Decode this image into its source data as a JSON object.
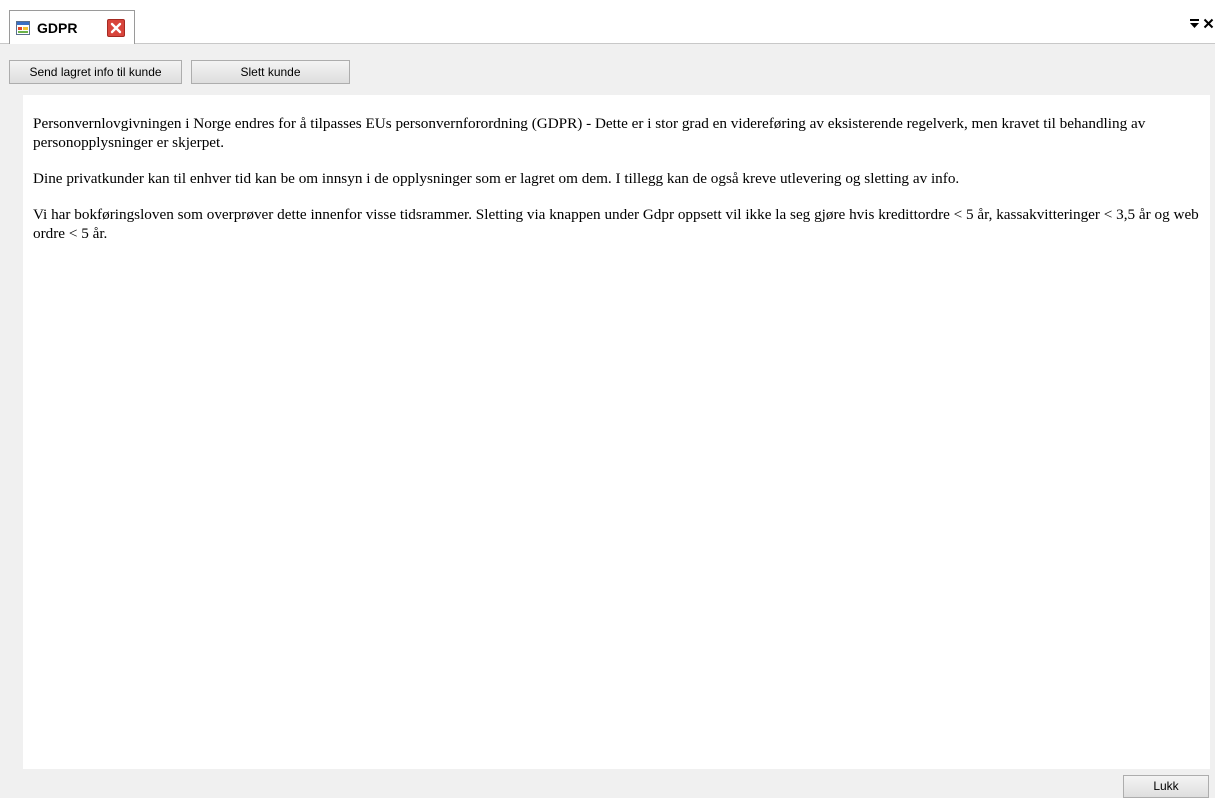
{
  "tab": {
    "title": "GDPR",
    "icon": "form-window-icon",
    "close_icon": "close-tab-icon"
  },
  "strip_controls": {
    "dropdown_icon": "tab-list-dropdown-icon",
    "close_icon": "close-icon"
  },
  "toolbar": {
    "send_label": "Send lagret info til kunde",
    "delete_label": "Slett kunde"
  },
  "content": {
    "paragraphs": [
      "Personvernlovgivningen i Norge endres for å tilpasses EUs personvernforordning (GDPR) - Dette er i stor grad en videreføring av eksisterende regelverk, men kravet til behandling av personopplysninger er skjerpet.",
      "Dine privatkunder kan til enhver tid kan be om innsyn i de opplysninger som er lagret om dem. I tillegg kan de også kreve utlevering og sletting av info.",
      "Vi har bokføringsloven som overprøver dette innenfor visse tidsrammer. Sletting via knappen under Gdpr oppsett vil ikke la seg gjøre hvis kredittordre < 5 år, kassakvitteringer < 3,5 år og web ordre < 5 år."
    ]
  },
  "footer": {
    "close_label": "Lukk"
  },
  "colors": {
    "panel_background": "#f0f0f0",
    "tab_close_red": "#d8453c",
    "text": "#000000"
  }
}
